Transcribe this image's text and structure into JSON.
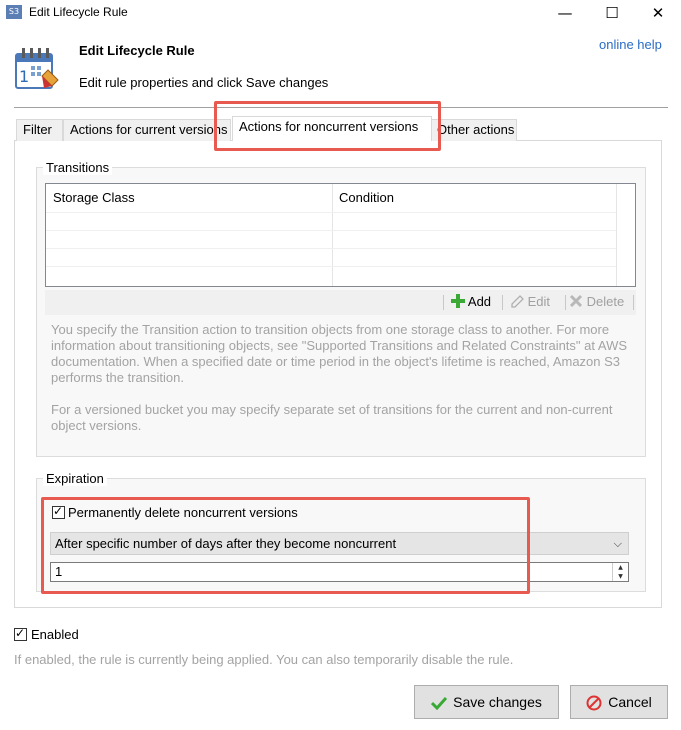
{
  "window": {
    "app_icon_text": "S3",
    "title": "Edit Lifecycle Rule",
    "minimize": "—",
    "maximize": "☐",
    "close": "✕"
  },
  "header": {
    "title": "Edit Lifecycle Rule",
    "subtitle": "Edit rule properties and click Save changes",
    "help_link": "online help"
  },
  "tabs": [
    {
      "label": "Filter"
    },
    {
      "label": "Actions for current versions"
    },
    {
      "label": "Actions for noncurrent versions",
      "active": true
    },
    {
      "label": "Other actions"
    }
  ],
  "transitions": {
    "group_label": "Transitions",
    "columns": [
      "Storage Class",
      "Condition"
    ],
    "rows": [],
    "toolbar": {
      "add": "Add",
      "edit": "Edit",
      "delete": "Delete"
    },
    "info_1": "You specify the Transition action to transition objects from one storage class to another. For more information about transitioning objects, see \"Supported Transitions and Related Constraints\" at AWS documentation. When a specified date or time period in the object's lifetime is reached, Amazon S3 performs the transition.",
    "info_2": "For a versioned bucket you may specify separate set of transitions for the current and non-current object versions."
  },
  "expiration": {
    "group_label": "Expiration",
    "checkbox_label": "Permanently delete noncurrent versions",
    "checked": true,
    "select_value": "After specific number of days after they become noncurrent",
    "days_value": "1"
  },
  "enabled": {
    "label": "Enabled",
    "checked": true,
    "note": "If enabled, the rule is currently being applied. You can also temporarily disable the rule."
  },
  "buttons": {
    "save": "Save changes",
    "cancel": "Cancel"
  },
  "colors": {
    "highlight": "#e85a4f",
    "link": "#2a6cc7",
    "add_icon": "#3aa935"
  }
}
